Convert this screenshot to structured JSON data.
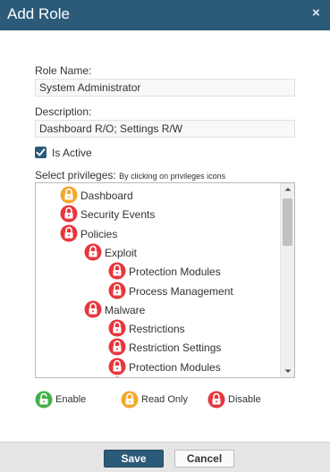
{
  "dialog": {
    "title": "Add Role",
    "close_glyph": "×"
  },
  "form": {
    "role_name_label": "Role Name:",
    "role_name_value": "System Administrator",
    "description_label": "Description:",
    "description_value": "Dashboard R/O; Settings R/W",
    "is_active_label": "Is Active",
    "is_active_checked": true
  },
  "privileges": {
    "label": "Select privileges:",
    "hint": "By clicking on privileges icons",
    "items": [
      {
        "label": "Dashboard",
        "state": "read-only",
        "level": 1
      },
      {
        "label": "Security Events",
        "state": "disable",
        "level": 1
      },
      {
        "label": "Policies",
        "state": "disable",
        "level": 1
      },
      {
        "label": "Exploit",
        "state": "disable",
        "level": 2
      },
      {
        "label": "Protection Modules",
        "state": "disable",
        "level": 3
      },
      {
        "label": "Process Management",
        "state": "disable",
        "level": 3
      },
      {
        "label": "Malware",
        "state": "disable",
        "level": 2
      },
      {
        "label": "Restrictions",
        "state": "disable",
        "level": 3
      },
      {
        "label": "Restriction Settings",
        "state": "disable",
        "level": 3
      },
      {
        "label": "Protection Modules",
        "state": "disable",
        "level": 3
      }
    ]
  },
  "legend": [
    {
      "label": "Enable",
      "state": "enable",
      "icon": "unlock-icon"
    },
    {
      "label": "Read Only",
      "state": "read-only",
      "icon": "lock-icon"
    },
    {
      "label": "Disable",
      "state": "disable",
      "icon": "lock-icon"
    }
  ],
  "colors": {
    "enable": "#44b04a",
    "read-only": "#f2a82b",
    "disable": "#e8363d",
    "header": "#2c5b79"
  },
  "footer": {
    "save_label": "Save",
    "cancel_label": "Cancel"
  }
}
